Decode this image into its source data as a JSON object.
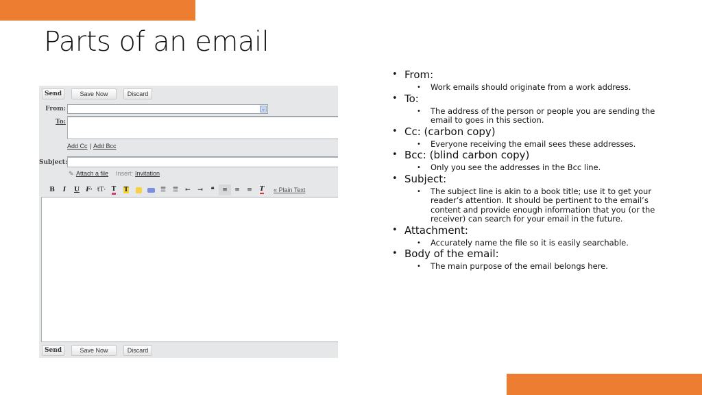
{
  "slide": {
    "title": "Parts of an email",
    "accent_color": "#ed7d31"
  },
  "compose": {
    "top_buttons": {
      "send": "Send",
      "save": "Save Now",
      "discard": "Discard"
    },
    "bottom_buttons": {
      "send": "Send",
      "save": "Save Now",
      "discard": "Discard"
    },
    "from_label": "From:",
    "from_value": "",
    "to_label": "To:",
    "to_value": "",
    "add_cc": "Add Cc",
    "separator": "|",
    "add_bcc": "Add Bcc",
    "subject_label": "Subject:",
    "subject_value": "",
    "attach_label": "Attach a file",
    "insert_label": "Insert:",
    "invitation_label": "Invitation",
    "plain_text_label": "« Plain Text",
    "body_value": "",
    "toolbar": [
      {
        "name": "bold-icon",
        "glyph": "B"
      },
      {
        "name": "italic-icon",
        "glyph": "I"
      },
      {
        "name": "underline-icon",
        "glyph": "U"
      },
      {
        "name": "font-icon",
        "glyph": "𝓕·"
      },
      {
        "name": "font-size-icon",
        "glyph": "ᴛT·"
      },
      {
        "name": "text-color-icon",
        "glyph": "T"
      },
      {
        "name": "highlight-color-icon",
        "glyph": "T"
      },
      {
        "name": "emoticon-icon",
        "glyph": "☺"
      },
      {
        "name": "link-icon",
        "glyph": "∞"
      },
      {
        "name": "numbered-list-icon",
        "glyph": "≡"
      },
      {
        "name": "bulleted-list-icon",
        "glyph": "☰"
      },
      {
        "name": "indent-less-icon",
        "glyph": "⇤"
      },
      {
        "name": "indent-more-icon",
        "glyph": "⇥"
      },
      {
        "name": "quote-icon",
        "glyph": "❝"
      },
      {
        "name": "align-left-icon",
        "glyph": "≣"
      },
      {
        "name": "align-center-icon",
        "glyph": "≡"
      },
      {
        "name": "align-right-icon",
        "glyph": "≡"
      },
      {
        "name": "remove-formatting-icon",
        "glyph": "T"
      }
    ]
  },
  "bullets": [
    {
      "heading": "From:",
      "detail": "Work emails should originate from a work address."
    },
    {
      "heading": "To:",
      "detail": "The address of the person or people you are sending the email to goes in this section."
    },
    {
      "heading": "Cc: (carbon copy)",
      "detail": "Everyone receiving the email sees these addresses."
    },
    {
      "heading": "Bcc: (blind carbon copy)",
      "detail": "Only you see the addresses in the Bcc line."
    },
    {
      "heading": "Subject:",
      "detail": "The subject line is akin to a book title; use it to get your reader’s attention. It should be pertinent to the email’s content and provide enough information that you (or the receiver) can search for your email in the future."
    },
    {
      "heading": "Attachment:",
      "detail": "Accurately name the file so it is easily searchable."
    },
    {
      "heading": "Body of the email:",
      "detail": "The main purpose of the email belongs here."
    }
  ]
}
